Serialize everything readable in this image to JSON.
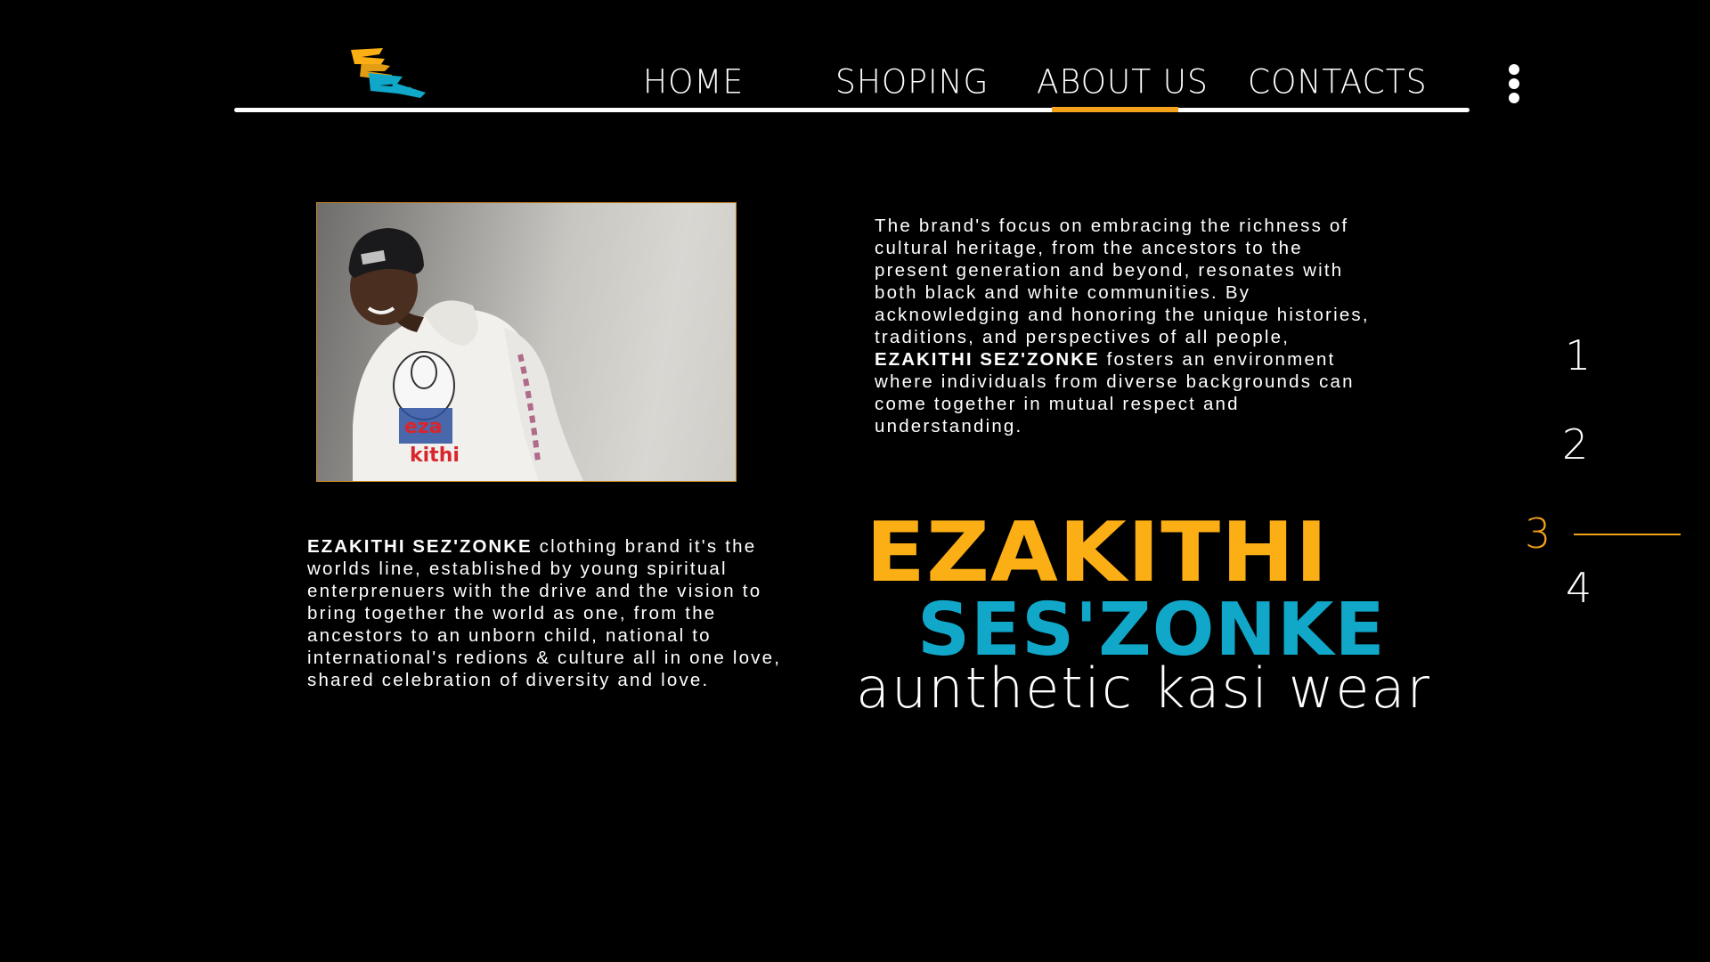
{
  "logo": {
    "name": "ezakithi-logo",
    "colors": [
      "#fcae15",
      "#10a7c9"
    ]
  },
  "nav": {
    "items": [
      {
        "label": "HOME"
      },
      {
        "label": "SHOPING"
      },
      {
        "label": "ABOUT US"
      },
      {
        "label": "CONTACTS"
      }
    ],
    "active_index": 2,
    "menu_icon": "kebab-menu-icon"
  },
  "about": {
    "photo_alt": "Man in black beanie and white hoodie with ezakithi print",
    "right_text": {
      "before": "The brand's focus on embracing the richness of cultural heritage, from the ancestors to the present generation and beyond, resonates with both black and white communities. By acknowledging and honoring the unique histories, traditions, and perspectives of all people, ",
      "bold": "EZAKITHI SEZ'ZONKE",
      "after": " fosters an environment where individuals from diverse backgrounds can come together in mutual respect and understanding."
    },
    "left_text": {
      "bold": "EZAKITHI SEZ'ZONKE",
      "after": " clothing brand it's the worlds line, established by young spiritual enterprenuers with the drive and the vision to bring together the world as one, from the ancestors to an unborn child, national to international's redions & culture all in one love, shared celebration of diversity and love."
    }
  },
  "brand": {
    "line1": "EZAKITHI",
    "line2": "SES'ZONKE",
    "tagline": "aunthetic kasi wear"
  },
  "pagination": {
    "pages": [
      "1",
      "2",
      "3",
      "4"
    ],
    "active": "3"
  },
  "colors": {
    "background": "#000000",
    "accent_orange": "#fcae15",
    "accent_blue": "#10a7c9",
    "text": "#ffffff"
  }
}
